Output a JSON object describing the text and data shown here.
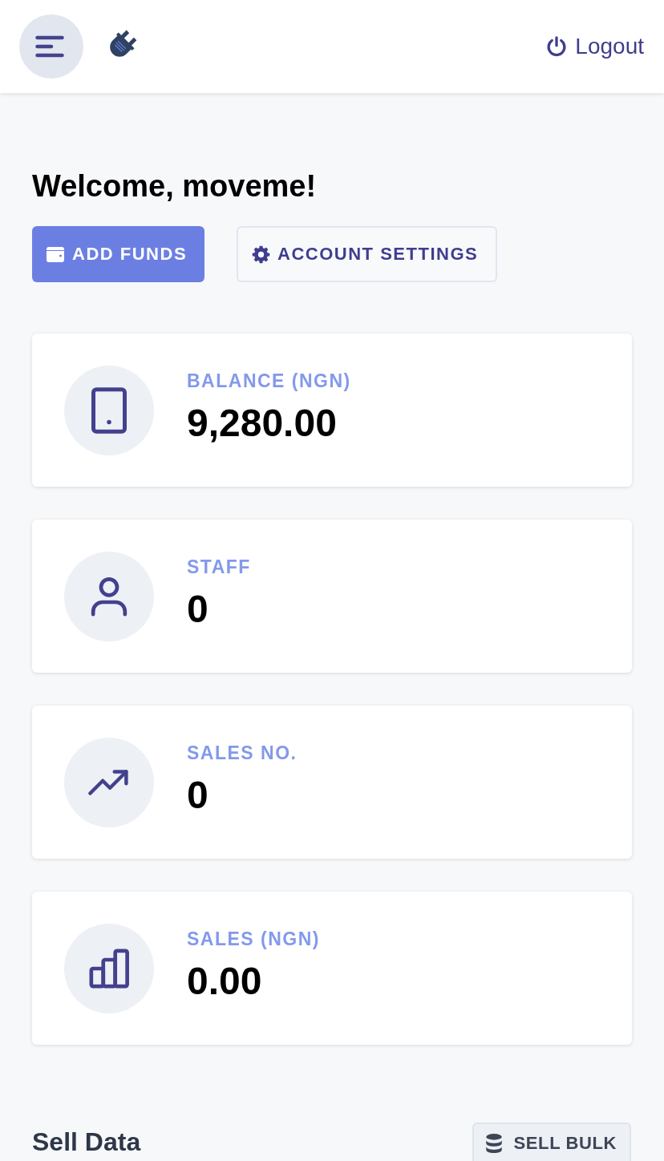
{
  "header": {
    "logout": {
      "label": "Logout"
    }
  },
  "welcome": {
    "title": "Welcome, moveme!",
    "actions": [
      {
        "label": "ADD FUNDS",
        "kind": "funds"
      },
      {
        "label": "ACCOUNT SETTINGS",
        "kind": "settings"
      }
    ]
  },
  "stats": [
    {
      "label": "BALANCE (NGN)",
      "value": "9,280.00",
      "kind": "balance"
    },
    {
      "label": "STAFF",
      "value": "0",
      "kind": "staff"
    },
    {
      "label": "SALES NO.",
      "value": "0",
      "kind": "count"
    },
    {
      "label": "SALES (NGN)",
      "value": "0.00",
      "kind": "revenue"
    }
  ],
  "sell_data": {
    "title": "Sell Data",
    "button": {
      "label": "SELL BULK"
    }
  }
}
